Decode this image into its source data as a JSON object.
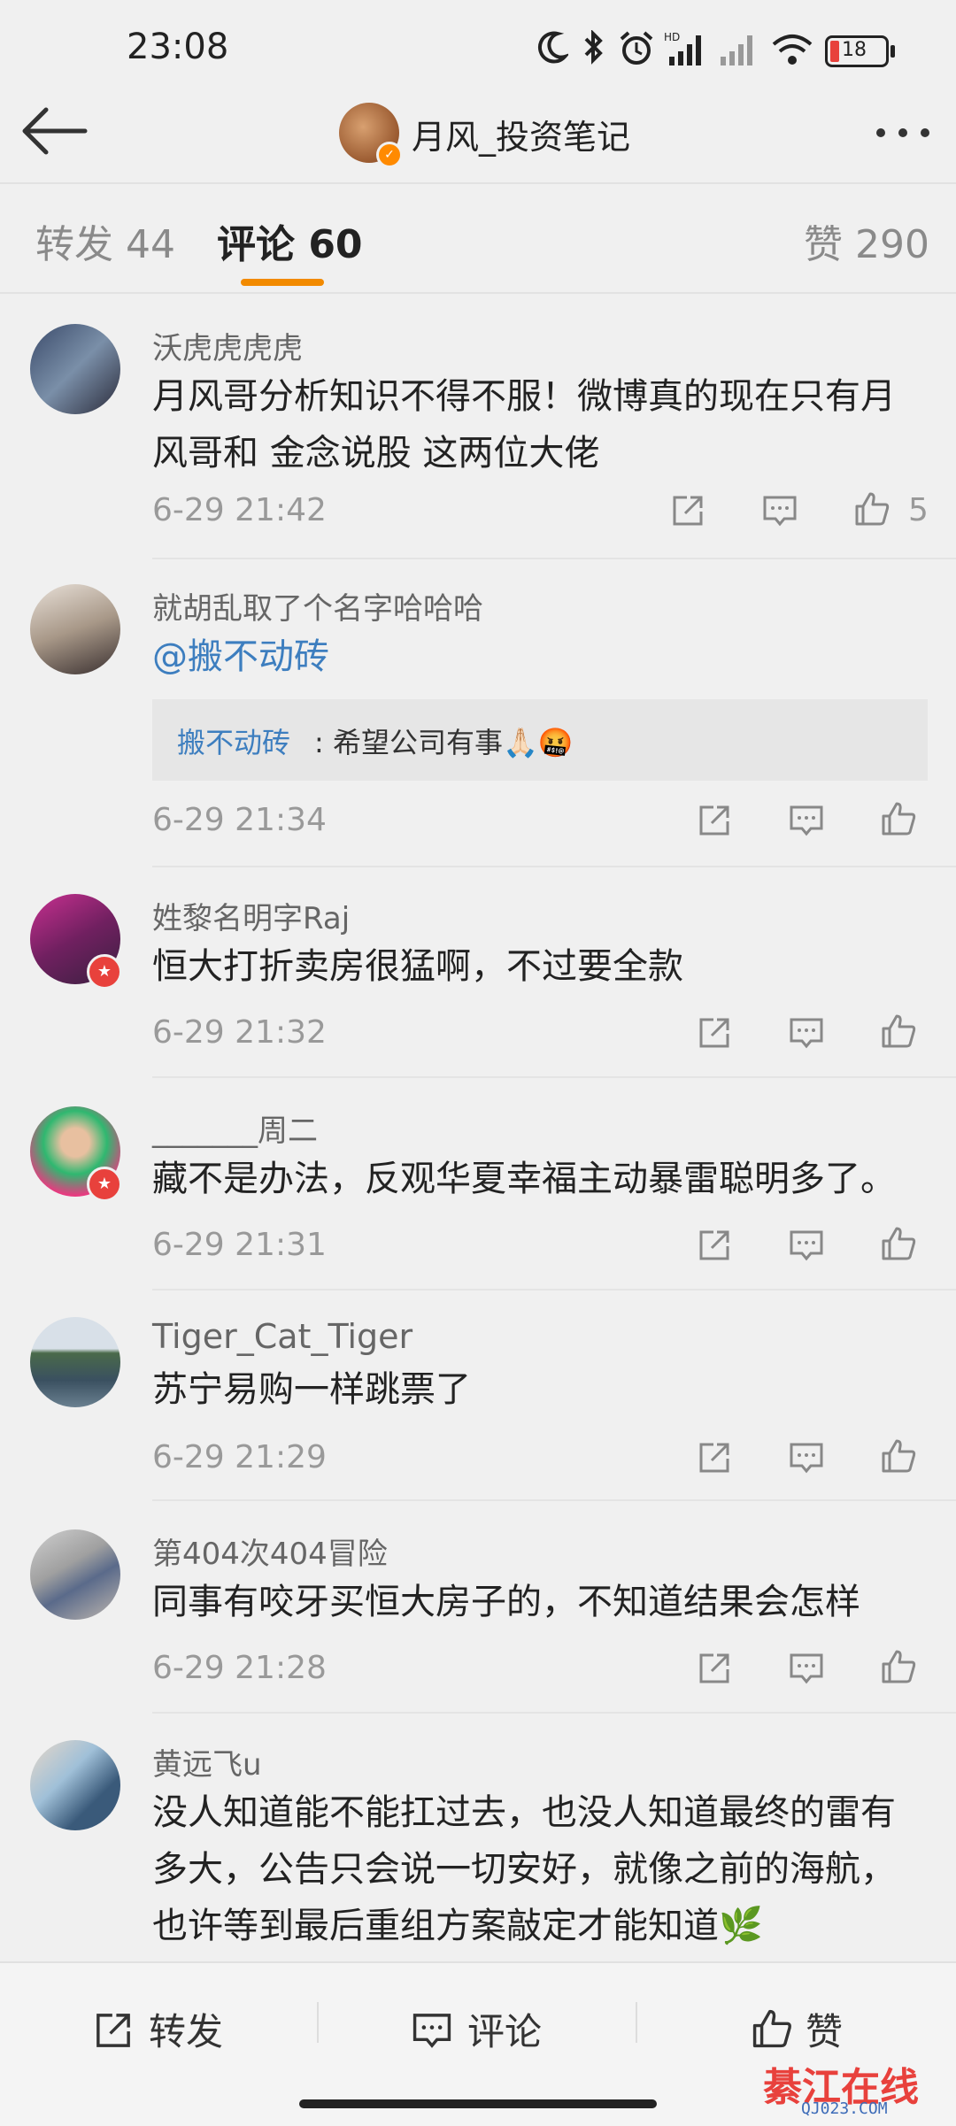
{
  "status_bar": {
    "time": "23:08",
    "battery": "18",
    "icons": [
      "moon-icon",
      "bluetooth-icon",
      "alarm-icon",
      "signal-hd-icon",
      "signal-icon",
      "wifi-icon",
      "battery-icon"
    ]
  },
  "nav": {
    "title": "月风_投资笔记"
  },
  "tabs": {
    "reposts": "转发 44",
    "comments": "评论 60",
    "likes": "赞 290",
    "accent": "#f28a00"
  },
  "comments": [
    {
      "user": "沃虎虎虎虎",
      "lines": [
        "月风哥分析知识不得不服！微博真的现在只有月",
        "风哥和 金念说股 这两位大佬"
      ],
      "time": "6-29 21:42",
      "likes": "5"
    },
    {
      "user": "就胡乱取了个名字哈哈哈",
      "lines": [
        "@搬不动砖"
      ],
      "quote_user": "搬不动砖",
      "quote_text": ": 希望公司有事🙏🏻🤬",
      "time": "6-29 21:34"
    },
    {
      "user": "姓黎名明字Raj",
      "lines": [
        "恒大打折卖房很猛啊，不过要全款"
      ],
      "time": "6-29 21:32"
    },
    {
      "user": "_______周二",
      "lines": [
        "藏不是办法，反观华夏幸福主动暴雷聪明多了。"
      ],
      "time": "6-29 21:31"
    },
    {
      "user": "Tiger_Cat_Tiger",
      "lines": [
        "苏宁易购一样跳票了"
      ],
      "time": "6-29 21:29"
    },
    {
      "user": "第404次404冒险",
      "lines": [
        "同事有咬牙买恒大房子的，不知道结果会怎样"
      ],
      "time": "6-29 21:28"
    },
    {
      "user": "黄远飞u",
      "lines": [
        "没人知道能不能扛过去，也没人知道最终的雷有",
        "多大，公告只会说一切安好，就像之前的海航，",
        "也许等到最后重组方案敲定才能知道🌿"
      ]
    }
  ],
  "bottom_bar": {
    "repost": "转发",
    "comment": "评论",
    "like": "赞"
  },
  "watermark": {
    "text": "綦江在线",
    "sub": "QJ023.COM"
  }
}
